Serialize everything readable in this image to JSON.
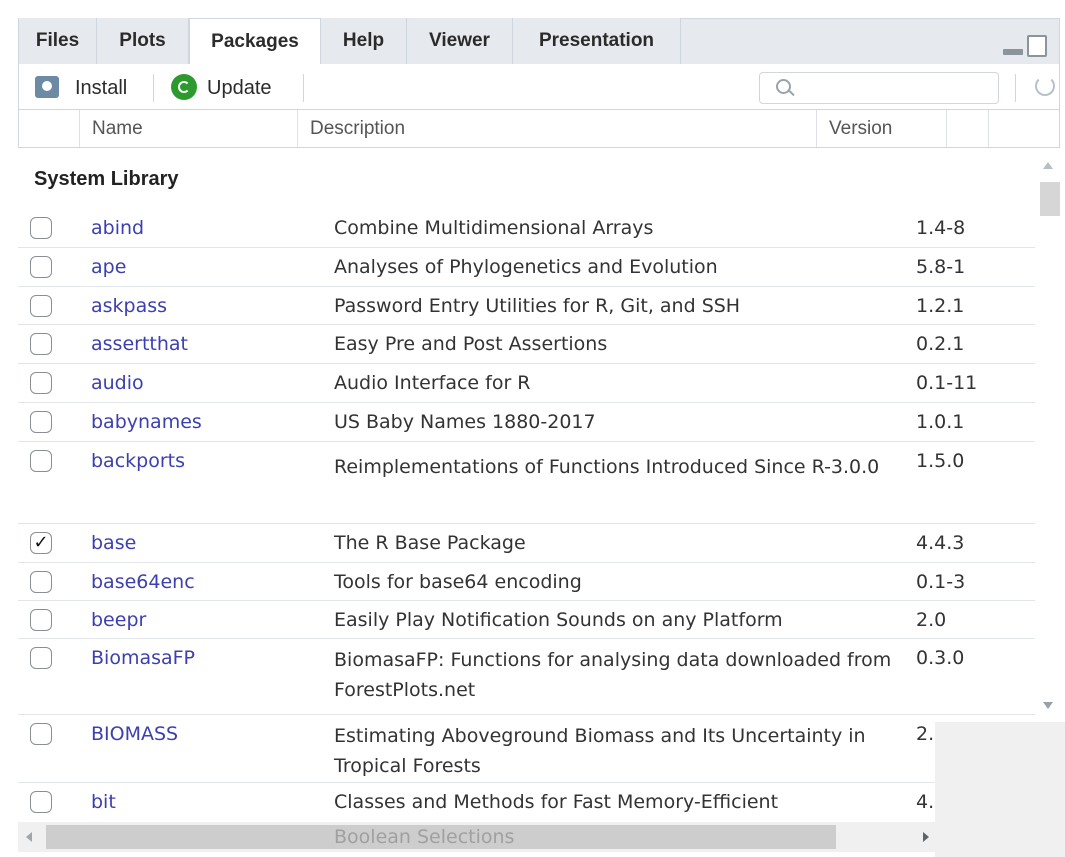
{
  "tabs": [
    {
      "label": "Files",
      "active": false
    },
    {
      "label": "Plots",
      "active": false
    },
    {
      "label": "Packages",
      "active": true
    },
    {
      "label": "Help",
      "active": false
    },
    {
      "label": "Viewer",
      "active": false
    },
    {
      "label": "Presentation",
      "active": false
    }
  ],
  "toolbar": {
    "install_label": "Install",
    "update_label": "Update",
    "search_placeholder": ""
  },
  "columns": {
    "name": "Name",
    "description": "Description",
    "version": "Version"
  },
  "section_title": "System Library",
  "packages": [
    {
      "name": "abind",
      "description": "Combine Multidimensional Arrays",
      "version": "1.4-8",
      "checked": false
    },
    {
      "name": "ape",
      "description": "Analyses of Phylogenetics and Evolution",
      "version": "5.8-1",
      "checked": false
    },
    {
      "name": "askpass",
      "description": "Password Entry Utilities for R, Git, and SSH",
      "version": "1.2.1",
      "checked": false
    },
    {
      "name": "assertthat",
      "description": "Easy Pre and Post Assertions",
      "version": "0.2.1",
      "checked": false
    },
    {
      "name": "audio",
      "description": "Audio Interface for R",
      "version": "0.1-11",
      "checked": false
    },
    {
      "name": "babynames",
      "description": "US Baby Names 1880-2017",
      "version": "1.0.1",
      "checked": false
    },
    {
      "name": "backports",
      "description": "Reimplementations of Functions Introduced Since R-3.0.0",
      "version": "1.5.0",
      "checked": false
    },
    {
      "name": "base",
      "description": "The R Base Package",
      "version": "4.4.3",
      "checked": true
    },
    {
      "name": "base64enc",
      "description": "Tools for base64 encoding",
      "version": "0.1-3",
      "checked": false
    },
    {
      "name": "beepr",
      "description": "Easily Play Notification Sounds on any Platform",
      "version": "2.0",
      "checked": false
    },
    {
      "name": "BiomasaFP",
      "description": "BiomasaFP: Functions for analysing data downloaded from ForestPlots.net",
      "version": "0.3.0",
      "checked": false
    },
    {
      "name": "BIOMASS",
      "description": "Estimating Aboveground Biomass and Its Uncertainty in Tropical Forests",
      "version": "2.",
      "checked": false
    },
    {
      "name": "bit",
      "description": "Classes and Methods for Fast Memory-Efficient",
      "version": "4.",
      "checked": false
    }
  ],
  "overflow_text": "Boolean Selections",
  "check_mark": "✓"
}
